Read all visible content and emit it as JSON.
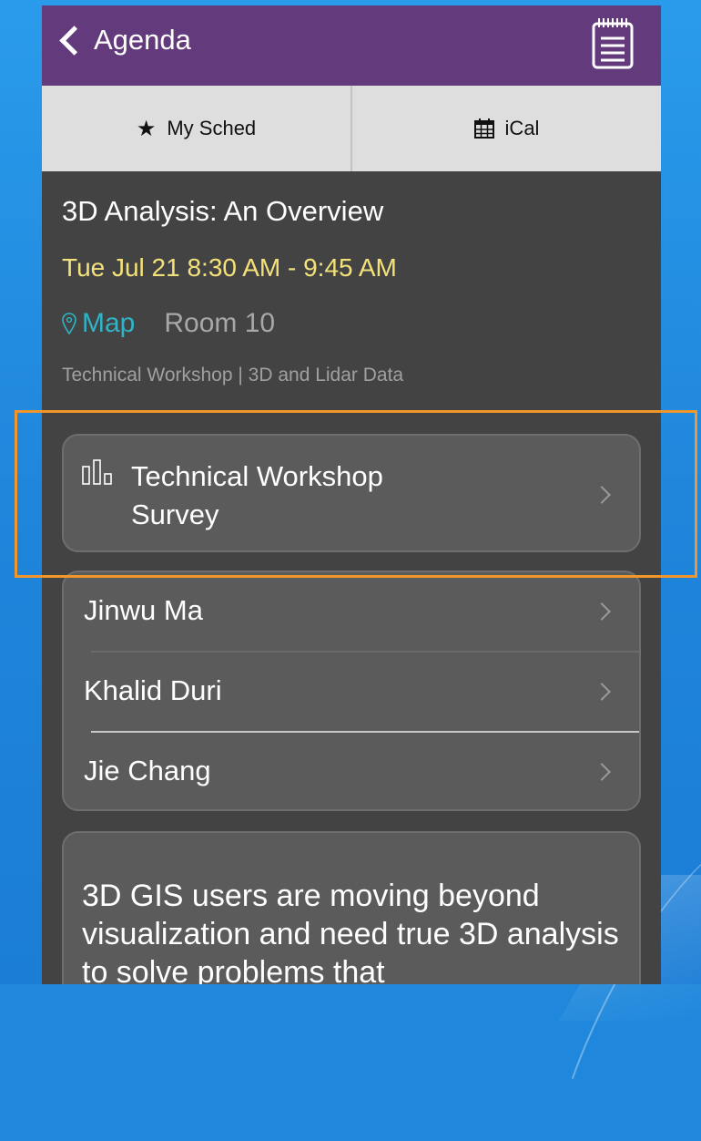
{
  "navbar": {
    "back_label": "Agenda",
    "notes_icon": "notes-icon",
    "color": "#633a7c"
  },
  "actions": {
    "my_sched_label": "My Sched",
    "my_sched_icon": "star-icon",
    "ical_label": "iCal",
    "ical_icon": "calendar-icon"
  },
  "session": {
    "title": "3D Analysis: An Overview",
    "time": "Tue Jul 21 8:30 AM - 9:45 AM",
    "map_label": "Map",
    "room": "Room 10",
    "tags": "Technical Workshop | 3D and Lidar Data"
  },
  "survey": {
    "line1": "Technical Workshop",
    "line2": "Survey",
    "icon": "bar-chart-icon"
  },
  "speakers": [
    {
      "name": "Jinwu Ma"
    },
    {
      "name": "Khalid Duri"
    },
    {
      "name": "Jie Chang"
    }
  ],
  "description": "3D GIS users are moving beyond visualization and need true 3D analysis to solve problems that",
  "colors": {
    "time": "#f3e27a",
    "map_link": "#2fb3c6",
    "highlight": "#f0962a",
    "background": "#1f88dc"
  }
}
